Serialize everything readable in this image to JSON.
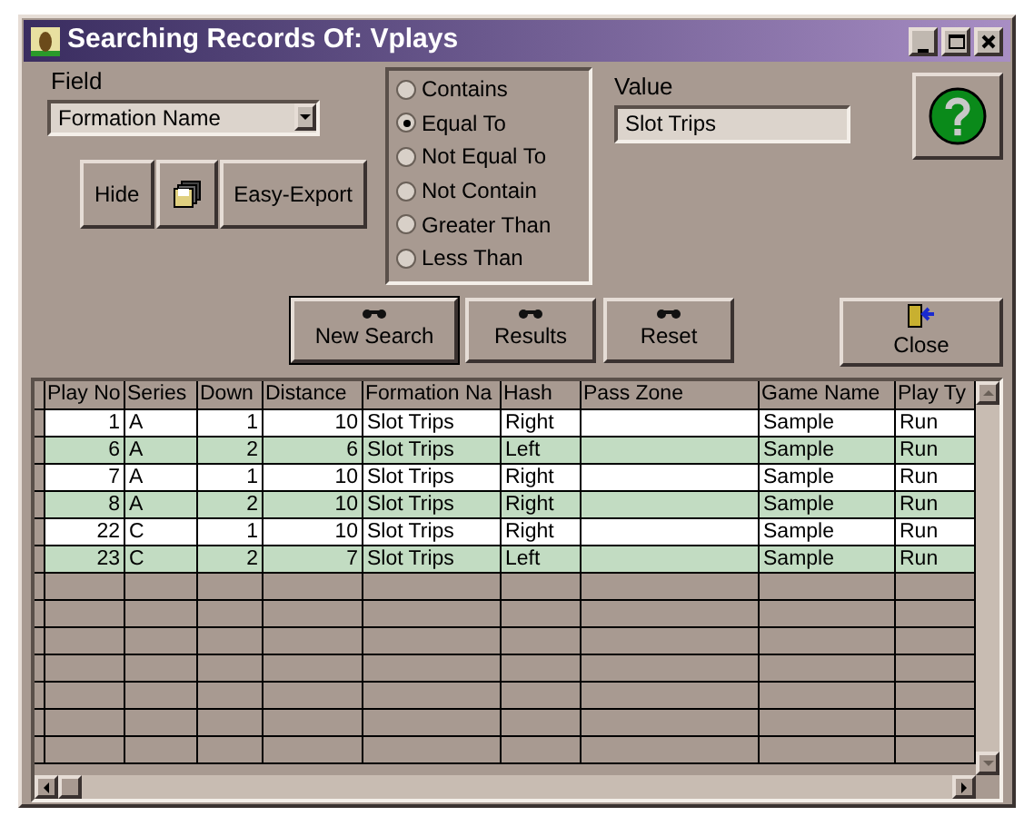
{
  "window": {
    "title": "Searching Records Of: Vplays"
  },
  "field": {
    "label": "Field",
    "value": "Formation Name"
  },
  "tools": [
    {
      "kind": "text",
      "label": "Hide"
    },
    {
      "kind": "icon"
    },
    {
      "kind": "text",
      "label": "Easy-Export"
    }
  ],
  "operators": [
    {
      "label": "Contains",
      "selected": false
    },
    {
      "label": "Equal To",
      "selected": true
    },
    {
      "label": "Not Equal To",
      "selected": false
    },
    {
      "label": "Not Contain",
      "selected": false
    },
    {
      "label": "Greater Than",
      "selected": false
    },
    {
      "label": "Less Than",
      "selected": false
    }
  ],
  "value": {
    "label": "Value",
    "value": "Slot Trips"
  },
  "actions": [
    {
      "label": "New Search",
      "focused": true
    },
    {
      "label": "Results",
      "focused": false
    },
    {
      "label": "Reset",
      "focused": false
    }
  ],
  "close": {
    "label": "Close"
  },
  "table": {
    "columns": [
      {
        "label": "Play No",
        "kind": "number"
      },
      {
        "label": "Series",
        "kind": "text"
      },
      {
        "label": "Down",
        "kind": "number"
      },
      {
        "label": "Distance",
        "kind": "number"
      },
      {
        "label": "Formation Na",
        "kind": "text"
      },
      {
        "label": "Hash",
        "kind": "text"
      },
      {
        "label": "Pass Zone",
        "kind": "text"
      },
      {
        "label": "Game Name",
        "kind": "text"
      },
      {
        "label": "Play Ty",
        "kind": "text"
      }
    ],
    "rows": [
      [
        "1",
        "A",
        "1",
        "10",
        "Slot Trips",
        "Right",
        "",
        "Sample",
        "Run"
      ],
      [
        "6",
        "A",
        "2",
        "6",
        "Slot Trips",
        "Left",
        "",
        "Sample",
        "Run"
      ],
      [
        "7",
        "A",
        "1",
        "10",
        "Slot Trips",
        "Right",
        "",
        "Sample",
        "Run"
      ],
      [
        "8",
        "A",
        "2",
        "10",
        "Slot Trips",
        "Right",
        "",
        "Sample",
        "Run"
      ],
      [
        "22",
        "C",
        "1",
        "10",
        "Slot Trips",
        "Right",
        "",
        "Sample",
        "Run"
      ],
      [
        "23",
        "C",
        "2",
        "7",
        "Slot Trips",
        "Left",
        "",
        "Sample",
        "Run"
      ]
    ]
  }
}
